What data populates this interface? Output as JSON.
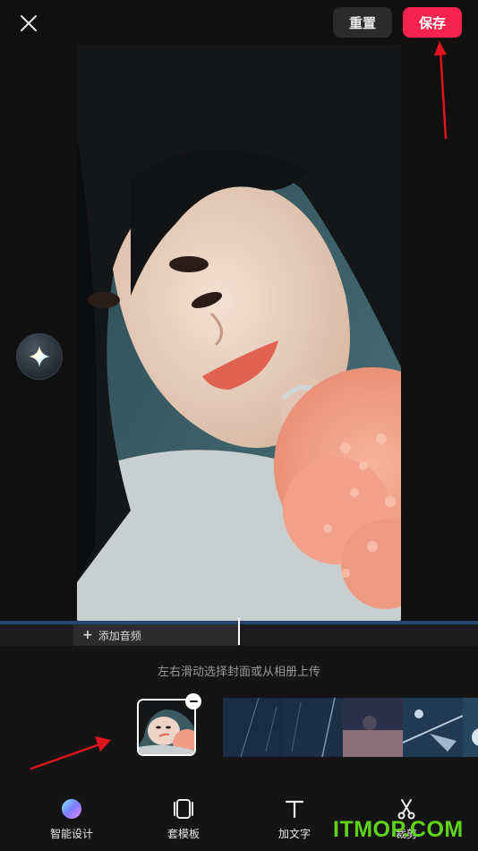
{
  "header": {
    "close_icon": "close-icon",
    "reset_label": "重置",
    "save_label": "保存",
    "save_color": "#f6234f"
  },
  "ai_button": {
    "icon": "sparkle-icon"
  },
  "timeline": {
    "add_audio_label": "添加音频"
  },
  "cover": {
    "hint": "左右滑动选择封面或从相册上传",
    "remove_icon": "minus-icon"
  },
  "toolbar": {
    "items": [
      {
        "label": "智能设计",
        "icon": "ai-orb-icon"
      },
      {
        "label": "套模板",
        "icon": "template-icon"
      },
      {
        "label": "加文字",
        "icon": "text-icon"
      },
      {
        "label": "裁剪",
        "icon": "scissors-icon"
      }
    ]
  },
  "watermark": {
    "text": "ITMOP.COM",
    "color": "#5fd31a"
  },
  "annotations": {
    "arrow_color": "#e0141e"
  }
}
